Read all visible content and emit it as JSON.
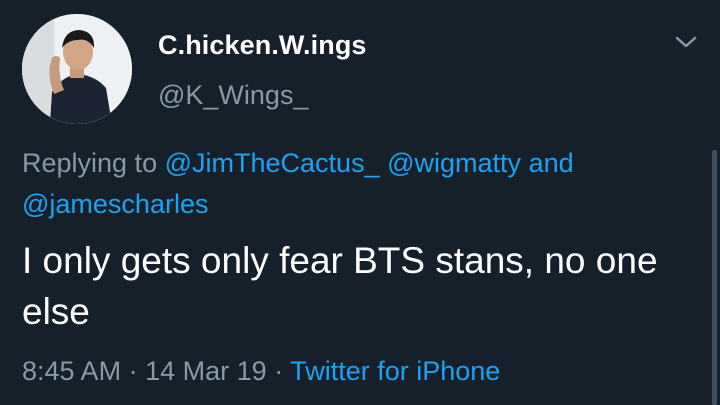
{
  "user": {
    "display_name": "C.hicken.W.ings",
    "handle": "@K_Wings_"
  },
  "reply": {
    "prefix": "Replying to",
    "mention_1": "@JimTheCactus_",
    "mention_2": "@wigmatty",
    "joiner": "and",
    "mention_3": "@jamescharles"
  },
  "tweet": {
    "text": "I only gets only fear BTS stans, no one else"
  },
  "meta": {
    "time": "8:45 AM",
    "separator": "·",
    "date": "14 Mar 19",
    "source": "Twitter for iPhone"
  },
  "icons": {
    "menu": "chevron-down-icon"
  },
  "colors": {
    "background": "#15202b",
    "primary_text": "#ffffff",
    "secondary_text": "#8899a6",
    "accent": "#1da1f2"
  }
}
